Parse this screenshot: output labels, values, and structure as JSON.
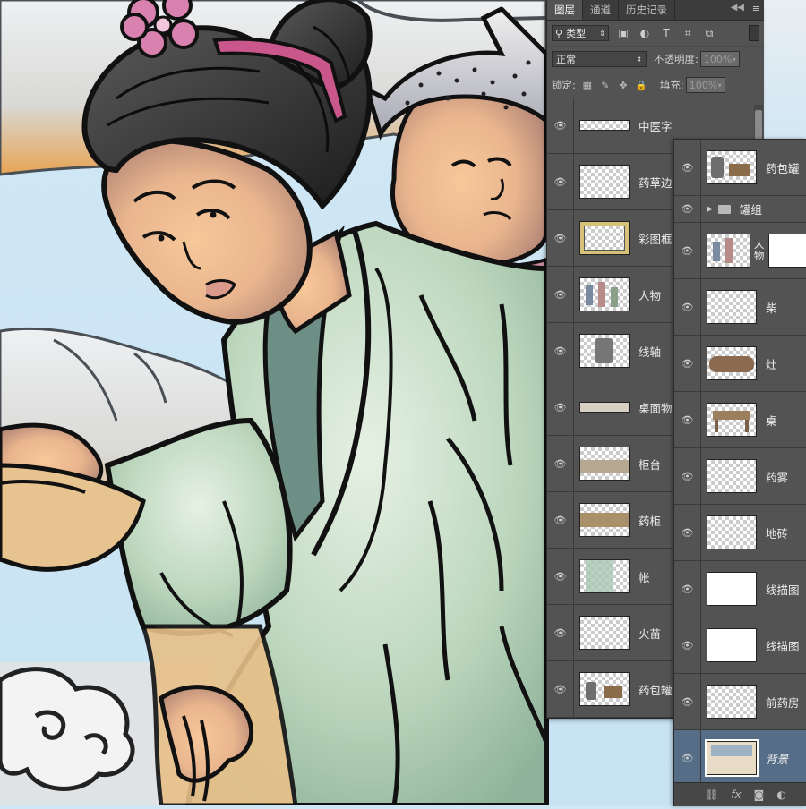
{
  "panel_main": {
    "tabs": [
      "图层",
      "通道",
      "历史记录"
    ],
    "menu_icon": "panel-menu-icon",
    "filter": {
      "value": "类型",
      "search_icon": "search-icon"
    },
    "filter_icons": [
      "image-filter-icon",
      "adjustment-filter-icon",
      "type-filter-icon",
      "shape-filter-icon",
      "smart-object-filter-icon"
    ],
    "blend_mode": "正常",
    "opacity_label": "不透明度:",
    "opacity_value": "100%",
    "lock_label": "锁定:",
    "fill_label": "填充:",
    "fill_value": "100%",
    "layers": [
      {
        "name": "中医字",
        "thumb": "strip"
      },
      {
        "name": "药草边",
        "thumb": "checker"
      },
      {
        "name": "彩图框",
        "thumb": "frame"
      },
      {
        "name": "人物",
        "thumb": "figures"
      },
      {
        "name": "线轴",
        "thumb": "spool"
      },
      {
        "name": "桌面物",
        "thumb": "objects"
      },
      {
        "name": "柜台",
        "thumb": "counter"
      },
      {
        "name": "药柜",
        "thumb": "cabinet"
      },
      {
        "name": "帐",
        "thumb": "curtain"
      },
      {
        "name": "火苗",
        "thumb": "flames"
      },
      {
        "name": "药包罐",
        "thumb": "jars"
      }
    ]
  },
  "panel_second": {
    "layers": [
      {
        "name": "药包罐",
        "type": "layer",
        "thumb": "jars"
      },
      {
        "name": "罐组",
        "type": "group"
      },
      {
        "name": "人物",
        "type": "masked",
        "thumb": "figures"
      },
      {
        "name": "柴",
        "type": "layer",
        "thumb": "sticks"
      },
      {
        "name": "灶",
        "type": "layer",
        "thumb": "stove"
      },
      {
        "name": "桌",
        "type": "layer",
        "thumb": "table"
      },
      {
        "name": "药雾",
        "type": "layer",
        "thumb": "mist"
      },
      {
        "name": "地砖",
        "type": "layer",
        "thumb": "checker"
      },
      {
        "name": "线描图",
        "type": "layer",
        "thumb": "lineart"
      },
      {
        "name": "线描图",
        "type": "layer",
        "thumb": "lineart"
      },
      {
        "name": "前药房",
        "type": "layer",
        "thumb": "checker"
      },
      {
        "name": "背景",
        "type": "selected",
        "thumb": "background"
      }
    ],
    "bottom_icons": [
      "link-layers-icon",
      "fx-icon",
      "add-mask-icon",
      "adjustment-layer-icon"
    ]
  },
  "colors": {
    "panel_bg": "#535353",
    "selected_layer": "#566d88",
    "sky": "#cfe6f4",
    "robe": "#b9d2b8"
  }
}
